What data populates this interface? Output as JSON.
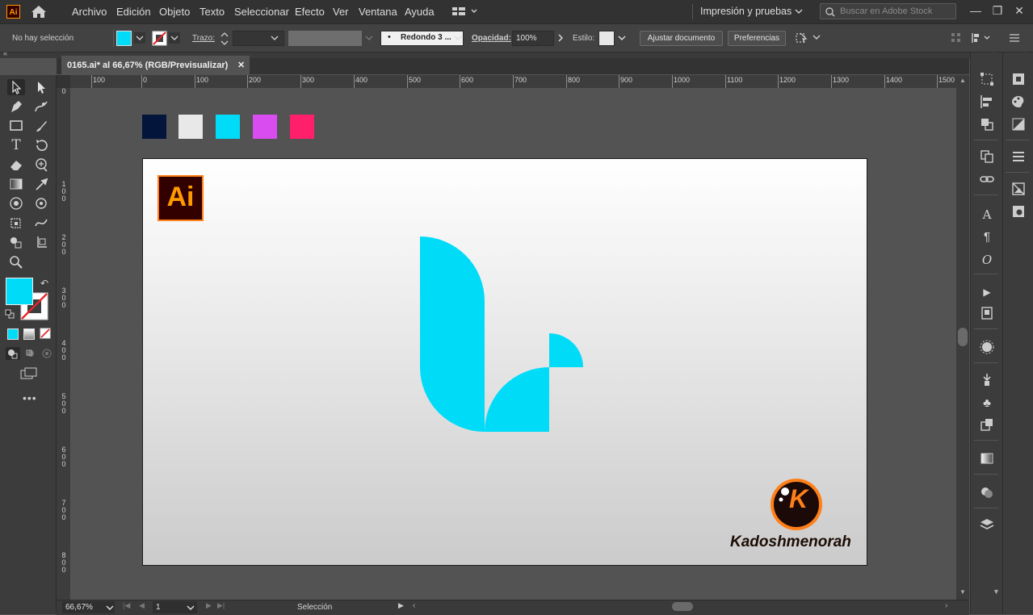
{
  "app": {
    "logo_text": "Ai"
  },
  "menu": {
    "items": [
      "Archivo",
      "Edición",
      "Objeto",
      "Texto",
      "Seleccionar",
      "Efecto",
      "Ver",
      "Ventana",
      "Ayuda"
    ],
    "workspace": "Impresión y pruebas",
    "search_placeholder": "Buscar en Adobe Stock"
  },
  "control": {
    "selection_status": "No hay selección",
    "stroke_label": "Trazo:",
    "brush_value": "Redondo 3 ...",
    "opacity_label": "Opacidad:",
    "opacity_value": "100%",
    "style_label": "Estilo:",
    "fit_document_label": "Ajustar documento",
    "preferences_label": "Preferencias"
  },
  "document": {
    "tab_title": "0165.ai* al 66,67% (RGB/Previsualizar)",
    "close_glyph": "✕"
  },
  "rulers": {
    "horizontal": [
      "100",
      "0",
      "100",
      "200",
      "300",
      "400",
      "500",
      "600",
      "700",
      "800",
      "900",
      "1000",
      "1100",
      "1200",
      "1300",
      "1400",
      "1500"
    ],
    "vertical": [
      "0",
      "1\n0\n0",
      "2\n0\n0",
      "3\n0\n0",
      "4\n0\n0",
      "5\n0\n0",
      "6\n0\n0",
      "7\n0\n0",
      "8\n0\n0"
    ]
  },
  "canvas": {
    "swatches": [
      "#03153a",
      "#e8e8e8",
      "#00dcf8",
      "#d84cf0",
      "#ff1f6a"
    ],
    "logo_color": "#00dcf8",
    "ai_badge_text": "Ai",
    "brand_text": "Kadoshmenorah",
    "brand_badge_letter": "K"
  },
  "colors": {
    "fill": "#00dcf8",
    "accent_orange": "#ff7f18"
  },
  "statusbar": {
    "zoom": "66,67%",
    "page": "1",
    "status": "Selección"
  }
}
